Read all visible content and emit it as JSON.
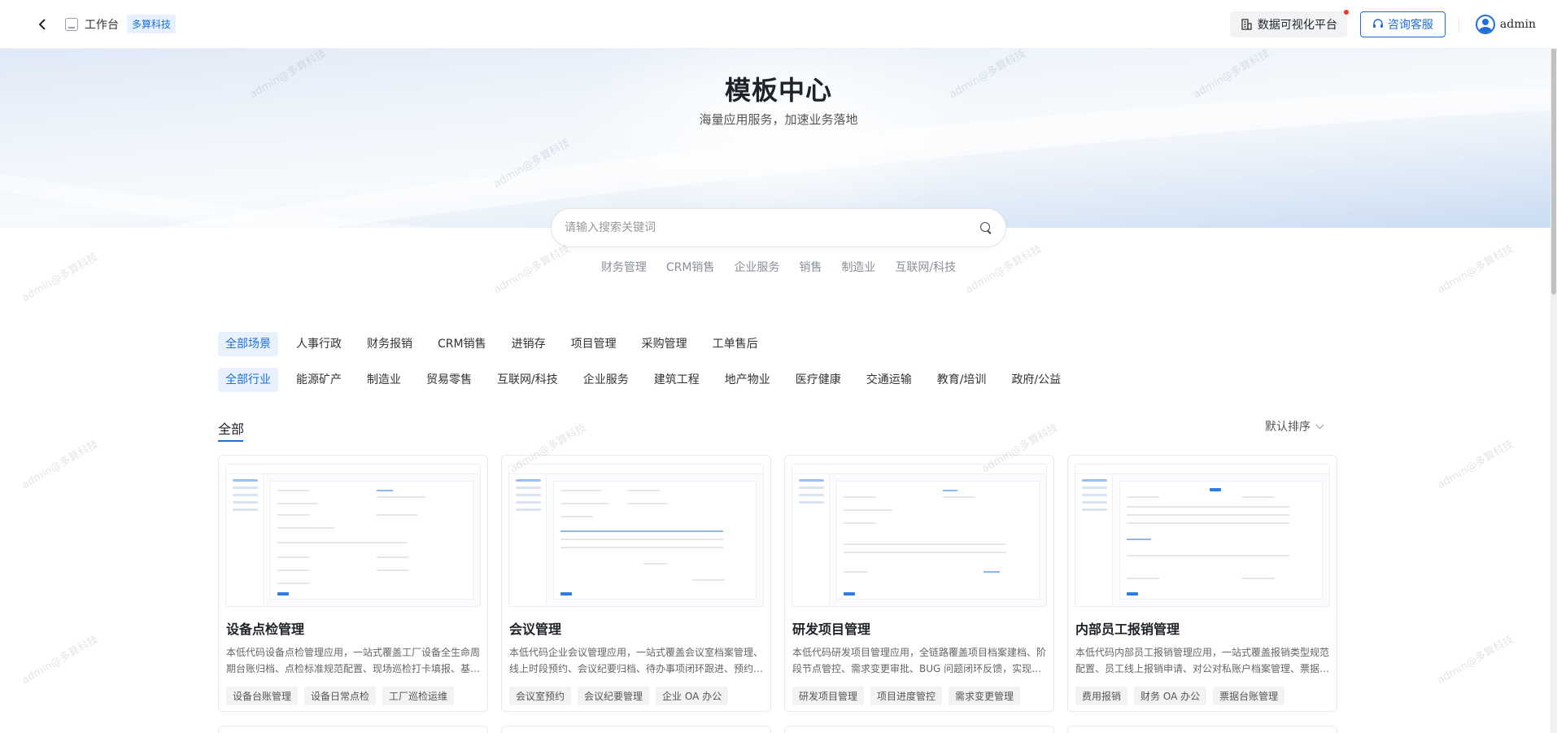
{
  "header": {
    "workspace_label": "工作台",
    "org_badge": "多算科技",
    "data_viz_label": "数据可视化平台",
    "consult_label": "咨询客服",
    "username": "admin"
  },
  "hero": {
    "title": "模板中心",
    "subtitle": "海量应用服务，加速业务落地"
  },
  "search": {
    "placeholder": "请输入搜索关键词",
    "hot_tags": [
      "财务管理",
      "CRM销售",
      "企业服务",
      "销售",
      "制造业",
      "互联网/科技"
    ]
  },
  "filters": {
    "scenes": [
      "全部场景",
      "人事行政",
      "财务报销",
      "CRM销售",
      "进销存",
      "项目管理",
      "采购管理",
      "工单售后"
    ],
    "industries": [
      "全部行业",
      "能源矿产",
      "制造业",
      "贸易零售",
      "互联网/科技",
      "企业服务",
      "建筑工程",
      "地产物业",
      "医疗健康",
      "交通运输",
      "教育/培训",
      "政府/公益"
    ]
  },
  "section": {
    "title": "全部",
    "sort_label": "默认排序"
  },
  "cards": [
    {
      "title": "设备点检管理",
      "desc": "本低代码设备点检管理应用，一站式覆盖工厂设备全生命周期台账归档、点检标准规范配置、现场巡检打卡填报、基…",
      "tags": [
        "设备台账管理",
        "设备日常点检",
        "工厂巡检运维"
      ]
    },
    {
      "title": "会议管理",
      "desc": "本低代码企业会议管理应用，一站式覆盖会议室档案管理、线上时段预约、会议纪要归档、待办事项闭环跟进、预约…",
      "tags": [
        "会议室预约",
        "会议纪要管理",
        "企业 OA 办公"
      ]
    },
    {
      "title": "研发项目管理",
      "desc": "本低代码研发项目管理应用，全链路覆盖项目档案建档、阶段节点管控、需求变更审批、BUG 问题闭环反馈，实现…",
      "tags": [
        "研发项目管理",
        "项目进度管控",
        "需求变更管理"
      ]
    },
    {
      "title": "内部员工报销管理",
      "desc": "本低代码内部员工报销管理应用，一站式覆盖报销类型规范配置、员工线上报销申请、对公对私账户档案管理、票据…",
      "tags": [
        "费用报销",
        "财务 OA 办公",
        "票据台账管理"
      ]
    }
  ],
  "watermark": "admin@多算科技",
  "colors": {
    "accent": "#1e6fd9",
    "accent_bg": "#e8f1fd",
    "notice_dot": "#e53935"
  }
}
